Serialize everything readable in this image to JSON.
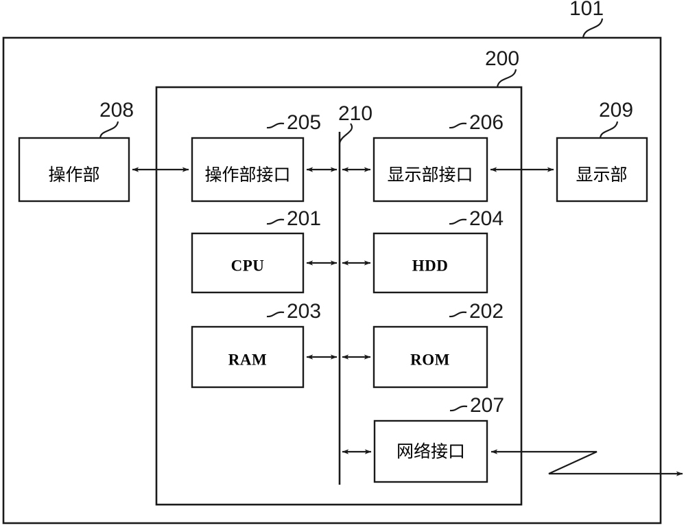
{
  "figure": {
    "title": "Information processing apparatus block diagram",
    "background_color": "#ffffff",
    "line_color": "#1a1a1a"
  },
  "outer_frame": {
    "ref": "101",
    "name": "apparatus-outer-frame"
  },
  "inner_frame": {
    "ref": "200",
    "name": "controller-inner-frame"
  },
  "bus": {
    "ref": "210",
    "name": "system-bus"
  },
  "blocks": [
    {
      "id": "operation-unit",
      "ref": "208",
      "label": "操作部",
      "script": "cjk"
    },
    {
      "id": "operation-unit-interface",
      "ref": "205",
      "label": "操作部接口",
      "script": "cjk"
    },
    {
      "id": "display-unit-interface",
      "ref": "206",
      "label": "显示部接口",
      "script": "cjk"
    },
    {
      "id": "display-unit",
      "ref": "209",
      "label": "显示部",
      "script": "cjk"
    },
    {
      "id": "cpu",
      "ref": "201",
      "label": "CPU",
      "script": "latin"
    },
    {
      "id": "hdd",
      "ref": "204",
      "label": "HDD",
      "script": "latin"
    },
    {
      "id": "ram",
      "ref": "203",
      "label": "RAM",
      "script": "latin"
    },
    {
      "id": "rom",
      "ref": "202",
      "label": "ROM",
      "script": "latin"
    },
    {
      "id": "network-interface",
      "ref": "207",
      "label": "网络接口",
      "script": "cjk"
    }
  ],
  "ref_numbers": {
    "n101": "101",
    "n200": "200",
    "n201": "201",
    "n202": "202",
    "n203": "203",
    "n204": "204",
    "n205": "205",
    "n206": "206",
    "n207": "207",
    "n208": "208",
    "n209": "209",
    "n210": "210"
  },
  "block_labels": {
    "operation_unit": "操作部",
    "operation_unit_interface": "操作部接口",
    "display_unit_interface": "显示部接口",
    "display_unit": "显示部",
    "cpu": "CPU",
    "hdd": "HDD",
    "ram": "RAM",
    "rom": "ROM",
    "network_interface": "网络接口"
  }
}
